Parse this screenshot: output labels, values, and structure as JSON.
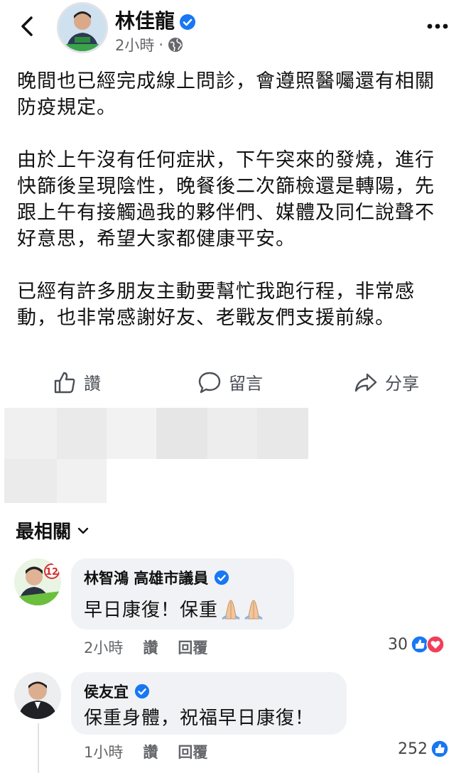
{
  "post": {
    "author": "林佳龍",
    "time": "2小時",
    "paragraphs": [
      "晚間也已經完成線上問診，會遵照醫囑還有相關防疫規定。",
      "由於上午沒有任何症狀，下午突來的發燒，進行快篩後呈現陰性，晚餐後二次篩檢還是轉陽，先跟上午有接觸過我的夥伴們、媒體及同仁說聲不好意思，希望大家都健康平安。",
      "已經有許多朋友主動要幫忙我跑行程，非常感動，也非常感謝好友、老戰友們支援前線。"
    ]
  },
  "actions": {
    "like": "讚",
    "comment": "留言",
    "share": "分享"
  },
  "comments_filter": "最相關",
  "comments": [
    {
      "name": "林智鴻 高雄市議員",
      "text": "早日康復！保重",
      "time": "2小時",
      "like": "讚",
      "reply": "回覆",
      "count": "30",
      "badge": "12"
    },
    {
      "name": "侯友宜",
      "text": "保重身體，祝福早日康復！",
      "time": "1小時",
      "like": "讚",
      "reply": "回覆",
      "count": "252"
    }
  ],
  "colors": {
    "verified": "#1877f2",
    "like": "#1877f2",
    "love": "#f33e58"
  }
}
